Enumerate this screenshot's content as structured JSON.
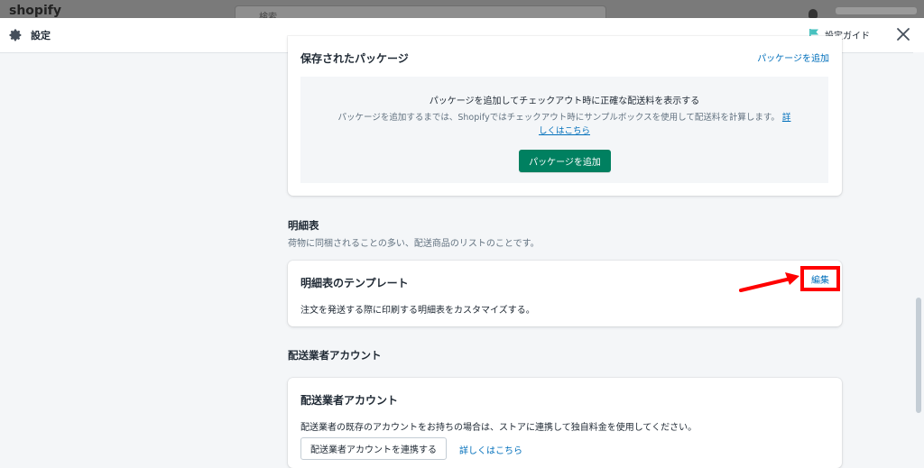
{
  "topbar": {
    "logo": "shopify",
    "search_placeholder": "検索"
  },
  "header": {
    "title": "設定",
    "guide_label": "設定ガイド"
  },
  "saved_packages": {
    "title": "保存されたパッケージ",
    "add_link": "パッケージを追加",
    "empty_heading": "パッケージを追加してチェックアウト時に正確な配送料を表示する",
    "empty_text": "パッケージを追加するまでは、Shopifyではチェックアウト時にサンプルボックスを使用して配送料を計算します。",
    "learn_more": "詳しくはこちら",
    "add_button": "パッケージを追加"
  },
  "packing_slip": {
    "section_title": "明細表",
    "section_desc": "荷物に同梱されることの多い、配送商品のリストのことです。",
    "card_title": "明細表のテンプレート",
    "edit_link": "編集",
    "card_desc": "注文を発送する際に印刷する明細表をカスタマイズする。"
  },
  "carrier_accounts": {
    "section_title": "配送業者アカウント",
    "card_title": "配送業者アカウント",
    "card_desc": "配送業者の既存のアカウントをお持ちの場合は、ストアに連携して独自料金を使用してください。",
    "connect_button": "配送業者アカウントを連携する",
    "learn_more": "詳しくはこちら"
  },
  "colors": {
    "primary_green": "#008060",
    "link_blue": "#006fbb",
    "highlight_red": "#ff0000"
  }
}
